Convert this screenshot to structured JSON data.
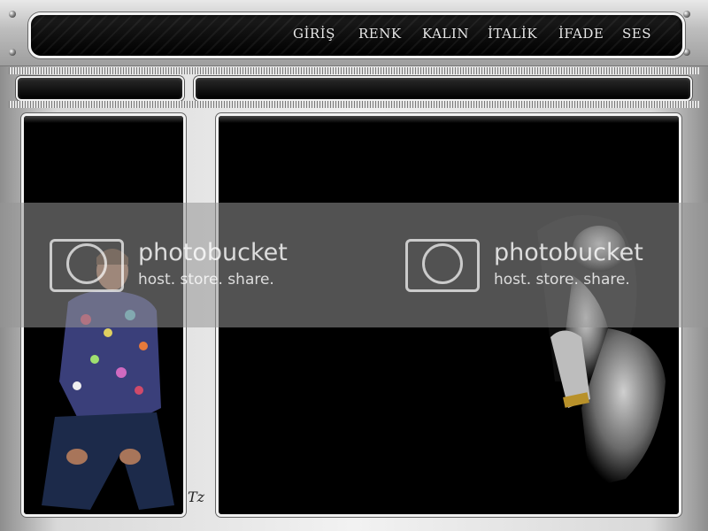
{
  "nav": {
    "items": [
      "GİRİŞ",
      "RENK",
      "KALIN",
      "İTALİK",
      "İFADE",
      "SES"
    ]
  },
  "watermark": {
    "title": "photobucket",
    "subtitle": "host. store. share."
  },
  "signature": "Tz",
  "colors": {
    "panel": "#000000",
    "frame_light": "#f2f2f2",
    "frame_dark": "#8e8e8e",
    "nav_text": "#e8e8e8"
  },
  "icons": [
    "screw-icon",
    "camera-icon"
  ]
}
